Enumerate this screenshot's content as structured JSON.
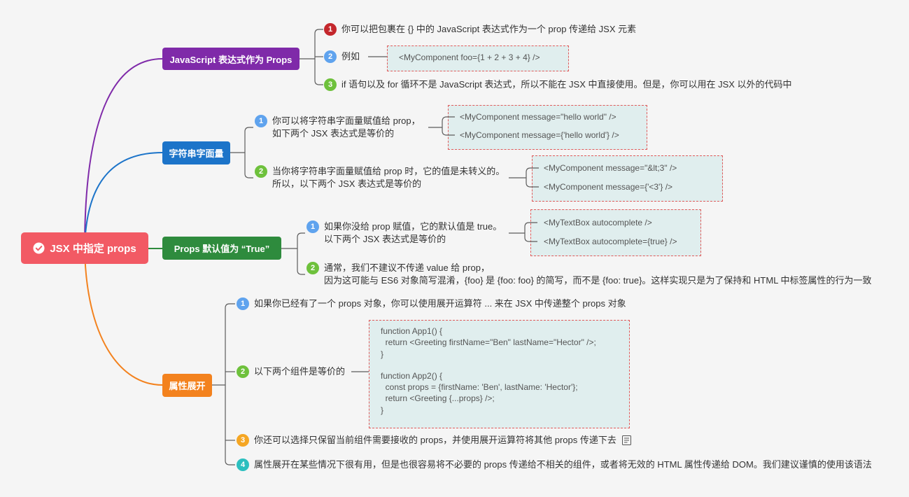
{
  "mindmap": {
    "root": {
      "label": "JSX 中指定 props",
      "icon": "check-circle-icon",
      "color": "#f25a64"
    },
    "branches": [
      {
        "label": "JavaScript 表达式作为 Props",
        "color": "#7f2aa9",
        "items": [
          {
            "number": "1",
            "badge_color": "#c4272c",
            "lines": [
              "你可以把包裹在 {} 中的 JavaScript 表达式作为一个 prop 传递给 JSX 元素"
            ]
          },
          {
            "number": "2",
            "badge_color": "#5fa3ee",
            "lines": [
              "例如"
            ],
            "code": [
              "<MyComponent foo={1 + 2 + 3 + 4} />"
            ]
          },
          {
            "number": "3",
            "badge_color": "#6ec13c",
            "lines": [
              "if 语句以及 for 循环不是 JavaScript 表达式，所以不能在 JSX 中直接使用。但是，你可以用在 JSX 以外的代码中"
            ]
          }
        ]
      },
      {
        "label": "字符串字面量",
        "color": "#1c74c9",
        "items": [
          {
            "number": "1",
            "badge_color": "#5fa3ee",
            "lines": [
              "你可以将字符串字面量赋值给 prop，",
              "如下两个 JSX 表达式是等价的"
            ],
            "code": [
              "<MyComponent message=\"hello world\" />",
              "<MyComponent message={'hello world'} />"
            ]
          },
          {
            "number": "2",
            "badge_color": "#6ec13c",
            "lines": [
              "当你将字符串字面量赋值给 prop 时，它的值是未转义的。",
              "所以，以下两个 JSX 表达式是等价的"
            ],
            "code": [
              "<MyComponent message=\"&lt;3\" />",
              "<MyComponent message={'<3'} />"
            ]
          }
        ]
      },
      {
        "label": "Props 默认值为 “True”",
        "color": "#2e8b3d",
        "items": [
          {
            "number": "1",
            "badge_color": "#5fa3ee",
            "lines": [
              "如果你没给 prop 赋值，它的默认值是 true。",
              "以下两个 JSX 表达式是等价的"
            ],
            "code": [
              "<MyTextBox autocomplete />",
              "<MyTextBox autocomplete={true} />"
            ]
          },
          {
            "number": "2",
            "badge_color": "#6ec13c",
            "lines": [
              "通常，我们不建议不传递 value 给 prop，",
              "因为这可能与 ES6 对象简写混淆，{foo} 是 {foo: foo} 的简写，而不是 {foo: true}。这样实现只是为了保持和 HTML 中标签属性的行为一致"
            ]
          }
        ]
      },
      {
        "label": "属性展开",
        "color": "#f3821e",
        "items": [
          {
            "number": "1",
            "badge_color": "#5fa3ee",
            "lines": [
              "如果你已经有了一个 props 对象，你可以使用展开运算符 ... 来在 JSX 中传递整个 props 对象"
            ]
          },
          {
            "number": "2",
            "badge_color": "#6ec13c",
            "lines": [
              "以下两个组件是等价的"
            ],
            "code": [
              "function App1() {",
              "  return <Greeting firstName=\"Ben\" lastName=\"Hector\" />;",
              "}",
              "function App2() {",
              "  const props = {firstName: 'Ben', lastName: 'Hector'};",
              "  return <Greeting {...props} />;",
              "}"
            ]
          },
          {
            "number": "3",
            "badge_color": "#f5a623",
            "lines": [
              "你还可以选择只保留当前组件需要接收的 props，并使用展开运算符将其他 props 传递下去"
            ],
            "note_icon": "note-icon"
          },
          {
            "number": "4",
            "badge_color": "#2cbfbf",
            "lines": [
              "属性展开在某些情况下很有用，但是也很容易将不必要的 props 传递给不相关的组件，或者将无效的 HTML 属性传递给 DOM。我们建议谨慎的使用该语法"
            ]
          }
        ]
      }
    ]
  }
}
